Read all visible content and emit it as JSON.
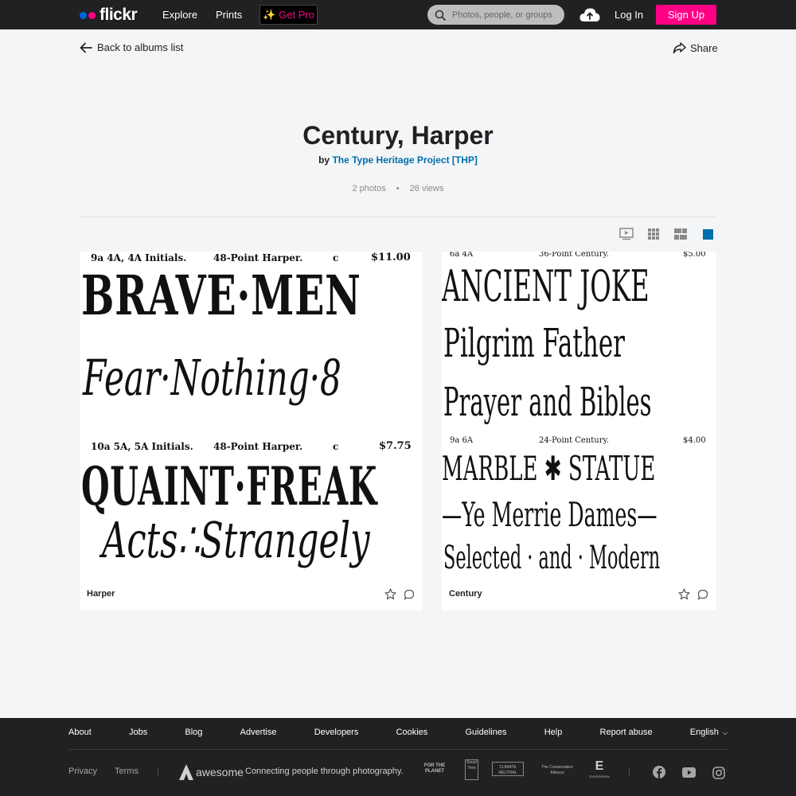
{
  "nav": {
    "logo": "flickr",
    "explore": "Explore",
    "prints": "Prints",
    "get_pro": "Get Pro",
    "search_placeholder": "Photos, people, or groups",
    "login": "Log In",
    "signup": "Sign Up"
  },
  "subnav": {
    "back": "Back to albums list",
    "share": "Share"
  },
  "album": {
    "title": "Century, Harper",
    "by": "by",
    "owner": "The Type Heritage Project [THP]",
    "photos": "2 photos",
    "views": "26 views"
  },
  "photos": [
    {
      "caption": "Harper",
      "lines": [
        "9a 4A, 4A Initials.",
        "48-Point Harper.",
        "c",
        "$11.00",
        "BRAVE·MEN",
        "Fear·Nothing·8",
        "10a 5A, 5A Initials.",
        "48-Point Harper.",
        "c",
        "$7.75",
        "QUAINT·FREAK",
        "Acts∴Strangely"
      ]
    },
    {
      "caption": "Century",
      "lines": [
        "6a 4A",
        "36-Point Century.",
        "$5.00",
        "ANCIENT JOKE",
        "Pilgrim Father",
        "Prayer and Bibles",
        "9a 6A",
        "24-Point Century.",
        "$4.00",
        "MARBLE ✱ STATUE",
        "—Ye Merrie Dames—",
        "Selected · and · Modern"
      ]
    }
  ],
  "footer": {
    "links": [
      "About",
      "Jobs",
      "Blog",
      "Advertise",
      "Developers",
      "Cookies",
      "Guidelines",
      "Help",
      "Report abuse",
      "English"
    ],
    "privacy": "Privacy",
    "terms": "Terms",
    "awesome": "awesome",
    "tagline": "Connecting people through photography.",
    "partners": [
      "FOR THE PLANET",
      "Smart Tree",
      "CLIMATE NEUTRAL",
      "The Conservation Alliance",
      "EVERGREEN"
    ]
  },
  "colors": {
    "brand_blue": "#0063dc",
    "brand_pink": "#ff0084",
    "link": "#006dac"
  }
}
